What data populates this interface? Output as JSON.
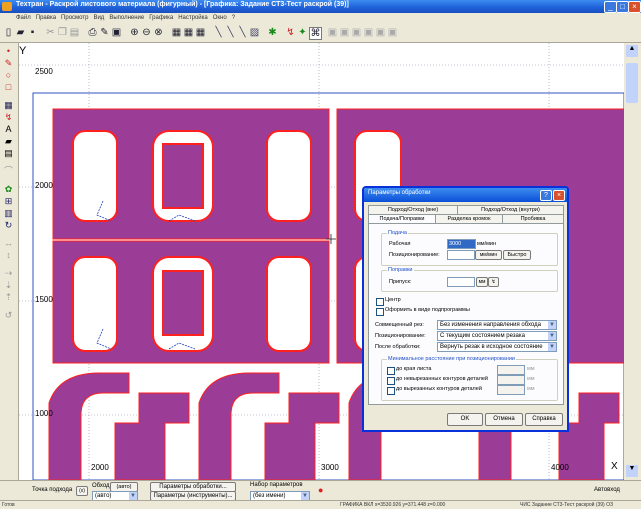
{
  "app": {
    "title": "Техтран - Раскрой листового материала (фигурный) - [Графика: Задание СТ3-Тест раскрой (39)]"
  },
  "menu": [
    "Файл",
    "Правка",
    "Просмотр",
    "Вид",
    "Выполнение",
    "Графика",
    "Настройка",
    "Окно",
    "?"
  ],
  "canvas": {
    "y_ticks": [
      "2500",
      "2000",
      "1500",
      "1000"
    ],
    "x_ticks": [
      "2000",
      "3000",
      "4000"
    ],
    "axis_y": "Y",
    "axis_x": "X"
  },
  "status_controls": {
    "point_label": "Точка подхода",
    "point_value": "(x)",
    "bypass_label": "Обход:",
    "bypass_value": "(авто)",
    "bypass_select": "(авто)",
    "params_button": "Параметры обработки...",
    "params_tools_button": "Параметры (инструменты)...",
    "paramset_label": "Набор параметров",
    "paramset_value": "(без имени)",
    "mode": "Автовход"
  },
  "statusbar": {
    "left": "Готов",
    "mid": "ГРАФИКА ВКЛ   x=3530.926 y=371.448 z=0.000",
    "right": "ЧИС  Задание СТ3-Тест раскрой (39) ОЗ"
  },
  "dialog": {
    "title": "Параметры обработки",
    "tabs_top": [
      "Подход/Отход (вне)",
      "Подход/Отход (внутри)"
    ],
    "tabs_bottom": [
      "Подача/Поправки",
      "Разделка кромок",
      "Пробивка"
    ],
    "feed_group": "Подача",
    "work_label": "Рабочая",
    "work_value": "3000",
    "work_unit": "мм/мин",
    "pos_label": "Позиционирование:",
    "pos_unit": "мм/мин",
    "fast_button": "Быстро",
    "corr_group": "Поправки",
    "allow_label": "Припуск:",
    "allow_unit": "мм",
    "center_label": "Центр",
    "subprog_label": "Оформить в виде подпрограммы",
    "combined_label": "Совмещенный рез:",
    "combined_value": "Без изменения направления обхода",
    "positioning_label": "Позиционирование:",
    "positioning_value": "С текущим состоянием резака",
    "after_label": "После обработки:",
    "after_value": "Вернуть резак в исходное состояние",
    "min_group": "Минимальное расстояние при позиционировании",
    "min_items": [
      "до края листа",
      "до невырезанных контуров деталей",
      "до вырезанных контуров деталей"
    ],
    "min_unit": "мм",
    "ok": "OK",
    "cancel": "Отмена",
    "help": "Справка"
  },
  "colors": {
    "part": "#9b3c96",
    "cut": "#ff2020"
  }
}
